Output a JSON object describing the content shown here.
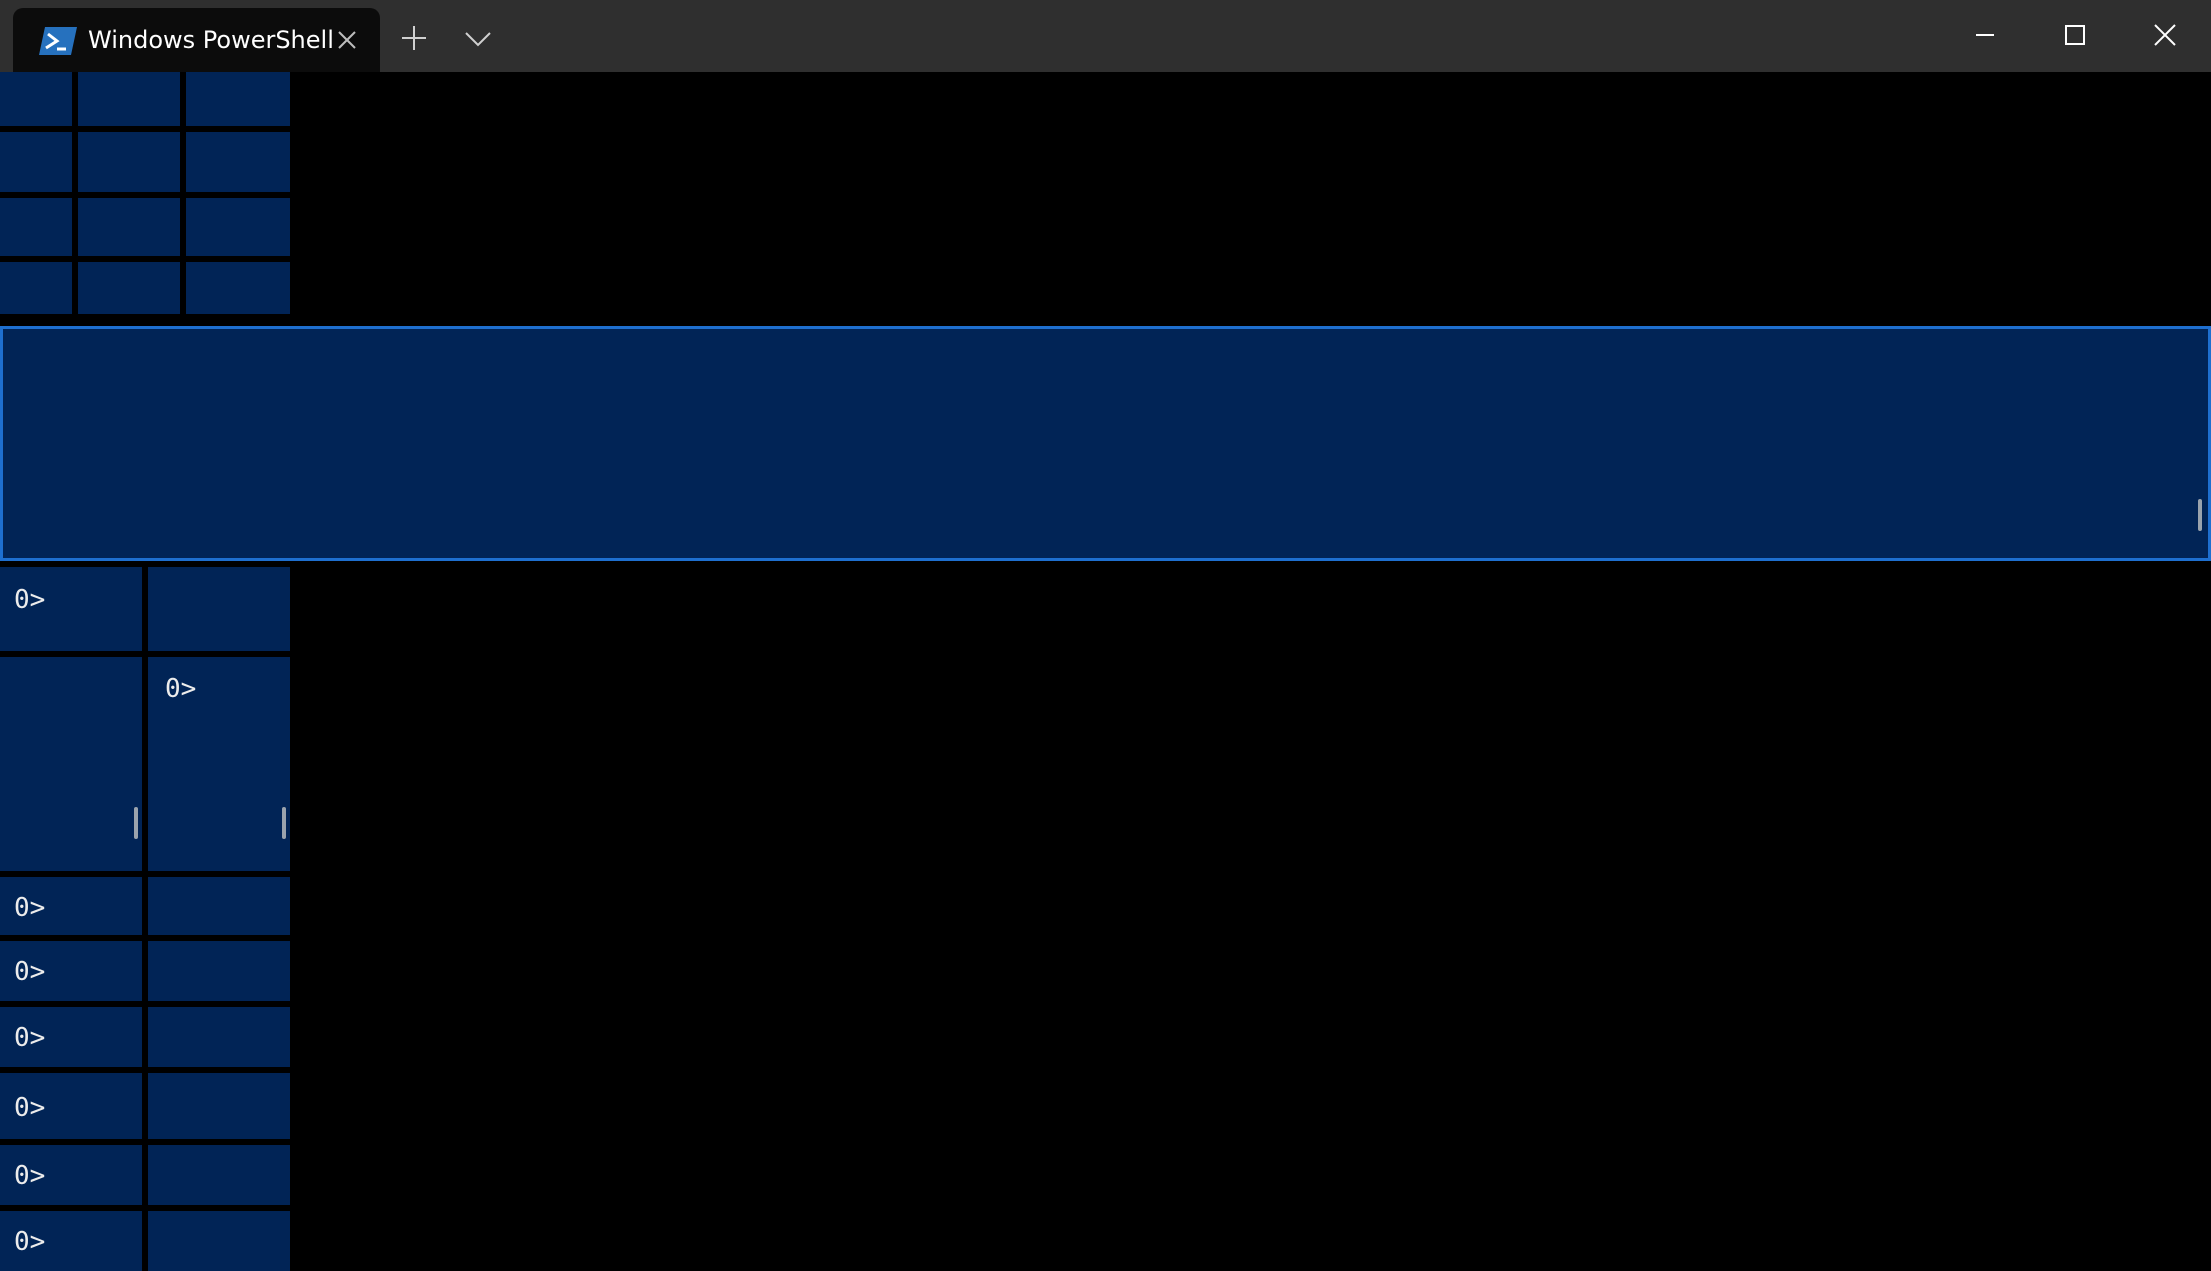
{
  "window": {
    "title_bar": {
      "tab": {
        "title": "Windows PowerShell",
        "icon": "powershell-icon",
        "close_icon": "close-icon"
      },
      "new_tab_icon": "plus-icon",
      "dropdown_icon": "chevron-down-icon",
      "caption_buttons": {
        "minimize_icon": "minimize-icon",
        "maximize_icon": "maximize-icon",
        "close_icon": "close-icon"
      }
    },
    "colors": {
      "titlebar_background": "#2f2f2f",
      "tab_background": "#0c0c0c",
      "terminal_background": "#000000",
      "pane_background": "#012456",
      "pane_divider": "#2f2f2f",
      "active_pane_border": "#1e6fcf",
      "prompt_text": "#ececec"
    }
  },
  "panes": {
    "prompt_text": "0>",
    "bottom_left_prompts": [
      "0>",
      "0>",
      "0>",
      "0>",
      "0>",
      "0>",
      "0>"
    ],
    "middle_right_prompt": "0>",
    "top_left_prompt": "0>"
  }
}
